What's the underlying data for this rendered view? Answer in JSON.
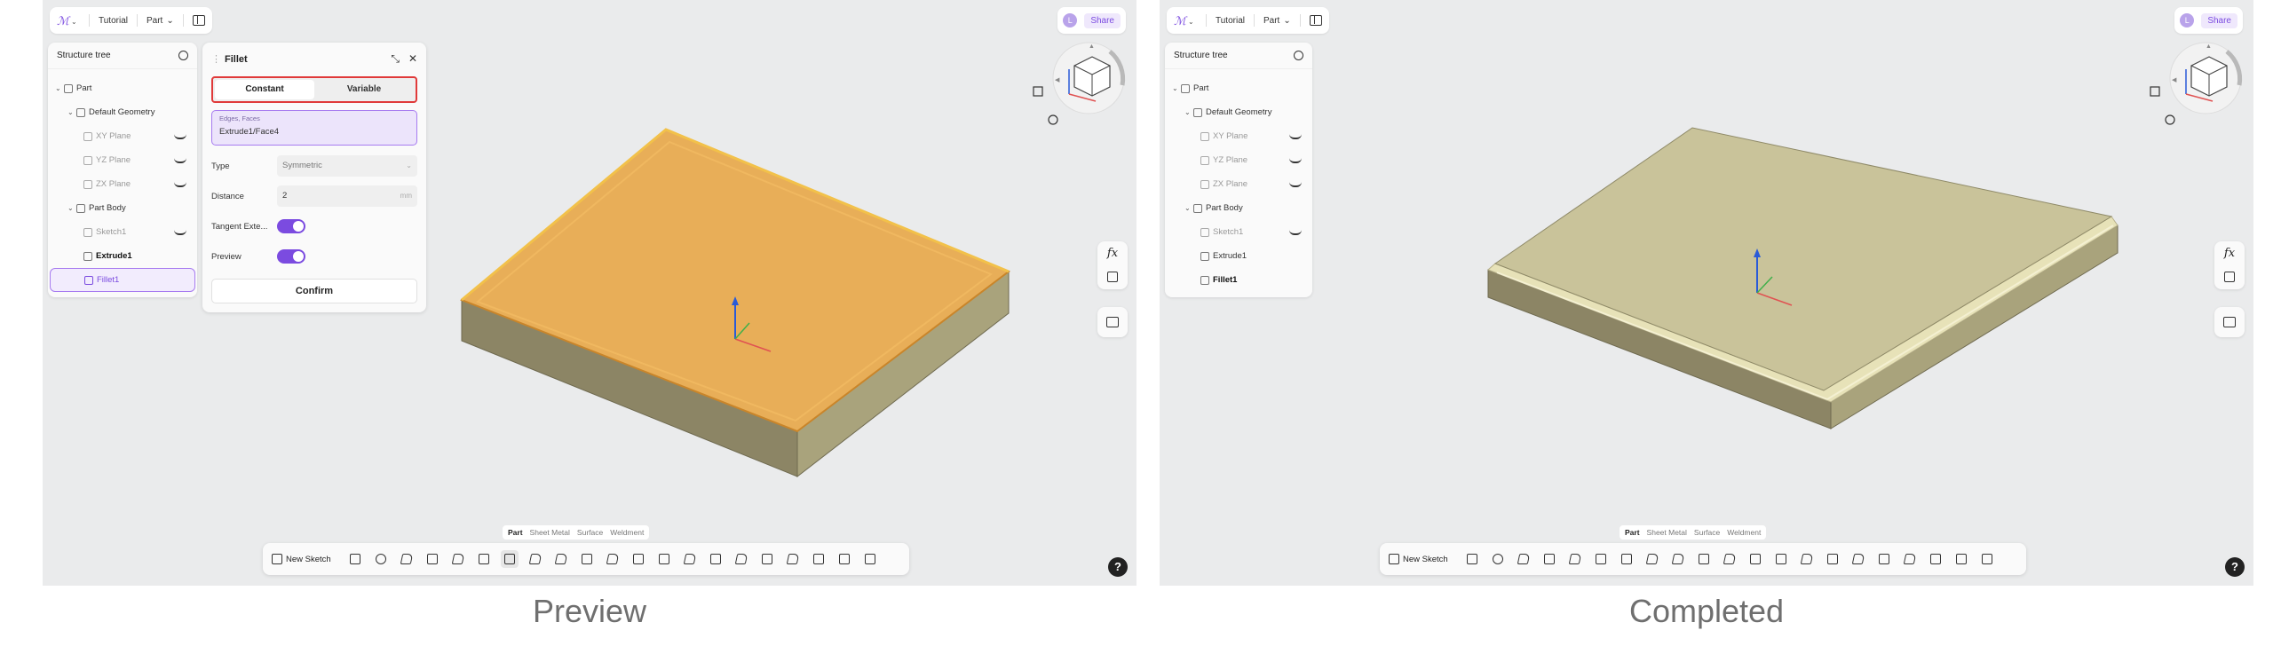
{
  "captions": {
    "left": "Preview",
    "right": "Completed"
  },
  "topbar": {
    "project": "Tutorial",
    "mode": "Part"
  },
  "share": {
    "avatar": "L",
    "label": "Share"
  },
  "tree": {
    "title": "Structure tree",
    "items": [
      "Part",
      "Default Geometry",
      "XY Plane",
      "YZ Plane",
      "ZX Plane",
      "Part Body",
      "Sketch1",
      "Extrude1",
      "Fillet1"
    ]
  },
  "fillet": {
    "title": "Fillet",
    "tabs": [
      "Constant",
      "Variable"
    ],
    "faces_label": "Edges, Faces",
    "faces_value": "Extrude1/Face4",
    "type_label": "Type",
    "type_value": "Symmetric",
    "distance_label": "Distance",
    "distance_value": "2",
    "distance_unit": "mm",
    "tangent_label": "Tangent Exte...",
    "preview_label": "Preview",
    "confirm": "Confirm"
  },
  "side_tools": {
    "fx": "fx"
  },
  "workbench_tabs": [
    "Part",
    "Sheet Metal",
    "Surface",
    "Weldment"
  ],
  "toolbar": {
    "new_sketch": "New Sketch"
  },
  "help": "?",
  "colors": {
    "accent": "#7b4be0",
    "highlight": "#e03a3a",
    "preview_fill": "#e8a33e",
    "model_top": "#c9c39a"
  }
}
